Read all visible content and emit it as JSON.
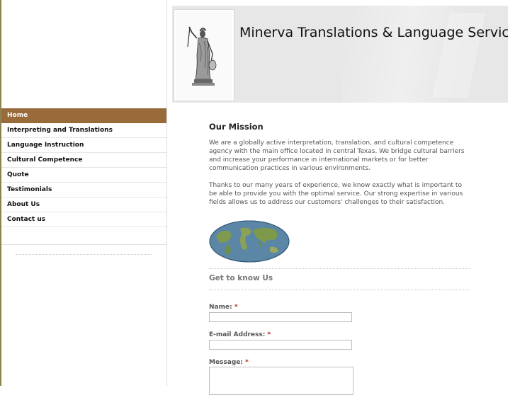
{
  "site": {
    "title": "Minerva Translations & Language Servic"
  },
  "nav": {
    "items": [
      {
        "label": "Home",
        "active": true
      },
      {
        "label": "Interpreting and Translations"
      },
      {
        "label": "Language Instruction"
      },
      {
        "label": "Cultural Competence"
      },
      {
        "label": "Quote"
      },
      {
        "label": "Testimonials"
      },
      {
        "label": "About Us"
      },
      {
        "label": "Contact us"
      }
    ]
  },
  "main": {
    "mission_title": "Our Mission",
    "paragraph1": "We are a globally active interpretation, translation, and cultural competence agency with the main office located in central Texas. We bridge cultural barriers and increase your performance in international markets or for better communication practices in various environments.",
    "paragraph2": "Thanks to our many years of experience, we know exactly what is important to be able to provide you with the optimal service. Our strong expertise in various fields allows us to address our customers' challenges to their satisfaction.",
    "section_title": "Get to know Us",
    "form": {
      "name_label": "Name:",
      "email_label": "E-mail Address:",
      "message_label": "Message:",
      "required_mark": "*"
    }
  },
  "colors": {
    "nav_active": "#9a6b3a",
    "required": "#b22222"
  },
  "icons": {
    "logo": "minerva-statue-icon",
    "globe": "world-map-globe-icon"
  }
}
